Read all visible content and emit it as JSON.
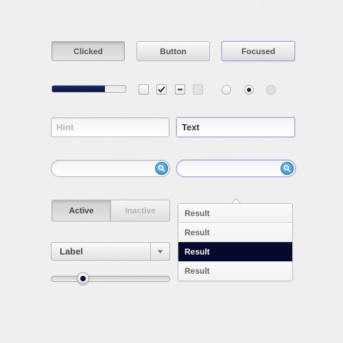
{
  "buttons": {
    "clicked_label": "Clicked",
    "button_label": "Button",
    "focused_label": "Focused"
  },
  "progress": {
    "value": 0.72,
    "fill_color": "#0a1240"
  },
  "checkboxes": [
    "unchecked",
    "checked",
    "indeterminate",
    "disabled"
  ],
  "radios": [
    "unselected",
    "selected",
    "disabled"
  ],
  "inputs": {
    "hint_placeholder": "Hint",
    "text_value": "Text"
  },
  "search": {
    "icon": "search-icon",
    "accent_color": "#2a86c4"
  },
  "segmented": {
    "active_label": "Active",
    "inactive_label": "Inactive"
  },
  "dropdown": {
    "label": "Label",
    "icon": "chevron-down-icon"
  },
  "slider": {
    "value": 0.22
  },
  "results": {
    "items": [
      "Result",
      "Result",
      "Result",
      "Result"
    ],
    "selected_index": 2,
    "selected_color": "#050a2c"
  }
}
